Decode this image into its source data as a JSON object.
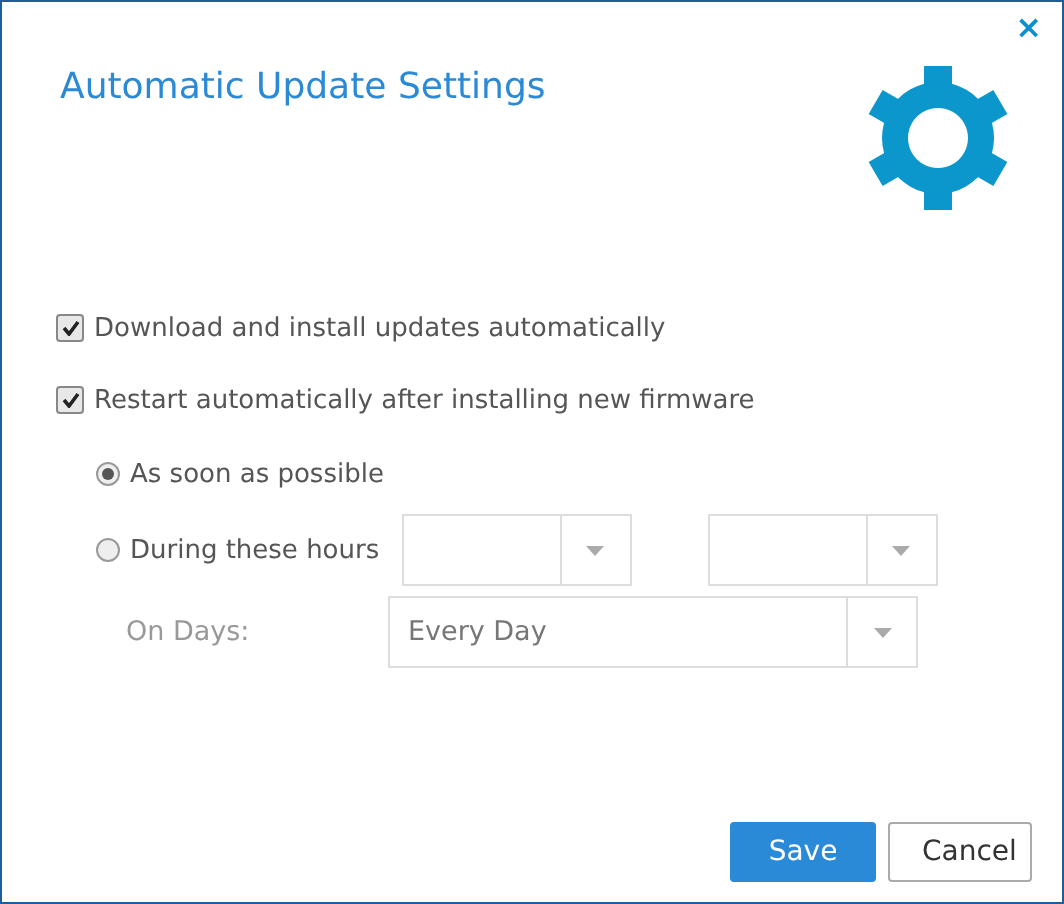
{
  "dialog": {
    "title": "Automatic Update Settings",
    "close": "×"
  },
  "checkboxes": [
    {
      "label": "Download and install updates automatically",
      "checked": true
    },
    {
      "label": "Restart automatically after installing new firmware",
      "checked": true
    }
  ],
  "schedule": [
    {
      "label": "As soon as possible",
      "selected": true
    },
    {
      "label": "During these hours",
      "selected": false
    }
  ],
  "days": {
    "label": "On Days:",
    "value": "Every Day"
  },
  "buttons": [
    {
      "label": "Save",
      "kind": "primary"
    },
    {
      "label": "Cancel",
      "kind": "secondary"
    }
  ]
}
